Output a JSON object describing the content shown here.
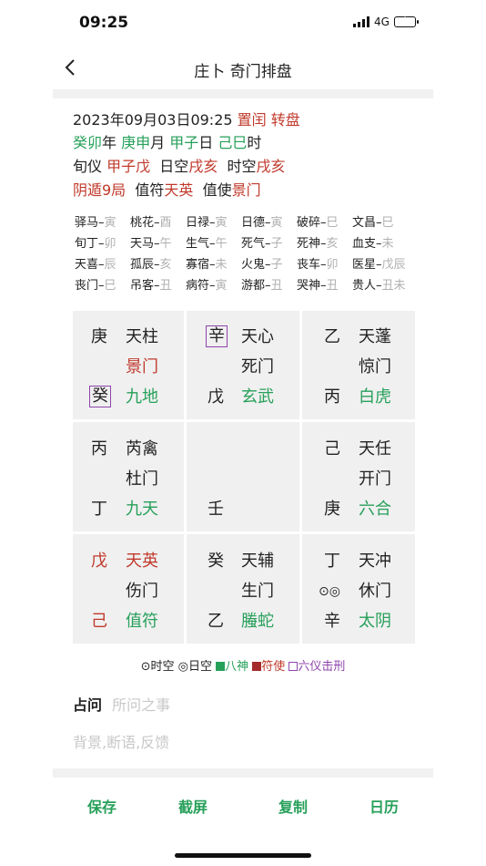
{
  "status": {
    "time": "09:25",
    "network": "4G"
  },
  "nav": {
    "title": "庄卜 奇门排盘"
  },
  "info": {
    "line1": {
      "datetime": "2023年09月03日09:25",
      "a": "置闰",
      "b": "转盘"
    },
    "line2": {
      "year": "癸卯",
      "year_sfx": "年",
      "month": "庚申",
      "month_sfx": "月",
      "day": "甲子",
      "day_sfx": "日",
      "hour": "己巳",
      "hour_sfx": "时"
    },
    "line3": {
      "xunyi_lbl": "旬仪",
      "xunyi": "甲子戊",
      "rikong_lbl": "日空",
      "rikong": "戌亥",
      "shikong_lbl": "时空",
      "shikong": "戌亥"
    },
    "line4": {
      "ju": "阴遁9局",
      "zhifu_lbl": "值符",
      "zhifu": "天英",
      "zhishi_lbl": "值使",
      "zhishi": "景门"
    }
  },
  "shensha": [
    [
      [
        "驿马",
        "寅"
      ],
      [
        "桃花",
        "酉"
      ],
      [
        "日禄",
        "寅"
      ],
      [
        "日德",
        "寅"
      ],
      [
        "破碎",
        "巳"
      ],
      [
        "文昌",
        "巳"
      ]
    ],
    [
      [
        "旬丁",
        "卯"
      ],
      [
        "天马",
        "午"
      ],
      [
        "生气",
        "午"
      ],
      [
        "死气",
        "子"
      ],
      [
        "死神",
        "亥"
      ],
      [
        "血支",
        "未"
      ]
    ],
    [
      [
        "天喜",
        "辰"
      ],
      [
        "孤辰",
        "亥"
      ],
      [
        "寡宿",
        "未"
      ],
      [
        "火鬼",
        "子"
      ],
      [
        "丧车",
        "卯"
      ],
      [
        "医星",
        "戊辰"
      ]
    ],
    [
      [
        "丧门",
        "巳"
      ],
      [
        "吊客",
        "丑"
      ],
      [
        "病符",
        "寅"
      ],
      [
        "游都",
        "丑"
      ],
      [
        "哭神",
        "丑"
      ],
      [
        "贵人",
        "丑未"
      ]
    ]
  ],
  "palaces": [
    {
      "tian": "庚",
      "star": "天柱",
      "door": "景门",
      "god": "九地",
      "di": "癸"
    },
    {
      "tian": "辛",
      "star": "天心",
      "door": "死门",
      "god": "玄武",
      "di": "戊"
    },
    {
      "tian": "乙",
      "star": "天蓬",
      "door": "惊门",
      "god": "白虎",
      "di": "丙"
    },
    {
      "tian": "丙",
      "star": "芮禽",
      "door": "杜门",
      "god": "九天",
      "di": "丁"
    },
    {
      "di": "壬"
    },
    {
      "tian": "己",
      "star": "天任",
      "door": "开门",
      "god": "六合",
      "di": "庚"
    },
    {
      "tian": "戊",
      "star": "天英",
      "door": "伤门",
      "god": "值符",
      "di": "己"
    },
    {
      "tian": "癸",
      "star": "天辅",
      "door": "生门",
      "god": "螣蛇",
      "di": "乙"
    },
    {
      "tian": "丁",
      "star": "天冲",
      "door": "休门",
      "god": "太阴",
      "di": "辛",
      "mark": "⊙◎"
    }
  ],
  "legend": {
    "shikong": "⊙时空",
    "rikong": "◎日空",
    "bashen": "八神",
    "fushi": "符使",
    "xing": "六仪击刑"
  },
  "ask": {
    "label": "占问",
    "placeholder": "所问之事",
    "bg_placeholder": "背景,断语,反馈"
  },
  "tabs": {
    "save": "保存",
    "screenshot": "截屏",
    "copy": "复制",
    "calendar": "日历"
  },
  "colors": {
    "red": "#c0392b",
    "green": "#27a05a",
    "purple": "#8e44ad"
  }
}
